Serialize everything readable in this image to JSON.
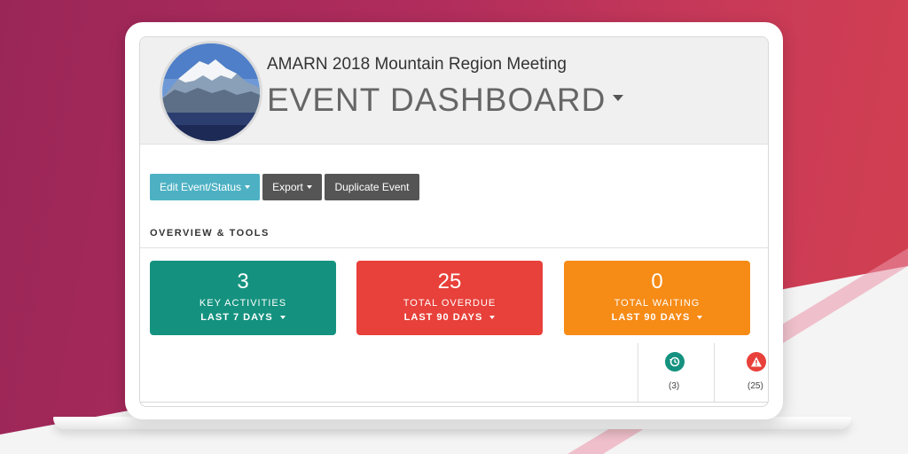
{
  "header": {
    "subtitle": "AMARN 2018 Mountain Region Meeting",
    "title": "EVENT DASHBOARD"
  },
  "toolbar": {
    "edit_label": "Edit Event/Status",
    "export_label": "Export",
    "duplicate_label": "Duplicate Event"
  },
  "section": {
    "label": "OVERVIEW & TOOLS"
  },
  "cards": [
    {
      "value": "3",
      "label": "KEY ACTIVITIES",
      "period": "LAST 7 DAYS",
      "color": "#14927f"
    },
    {
      "value": "25",
      "label": "TOTAL OVERDUE",
      "period": "LAST 90 DAYS",
      "color": "#e8403a"
    },
    {
      "value": "0",
      "label": "TOTAL WAITING",
      "period": "LAST 90 DAYS",
      "color": "#f68b16"
    }
  ],
  "status": [
    {
      "icon": "history-icon",
      "count": "(3)",
      "color": "#14927f"
    },
    {
      "icon": "warning-icon",
      "count": "(25)",
      "color": "#e8403a"
    }
  ],
  "colors": {
    "accent": "#4db1c3",
    "dark_button": "#555555",
    "background": "#b12d5c"
  }
}
